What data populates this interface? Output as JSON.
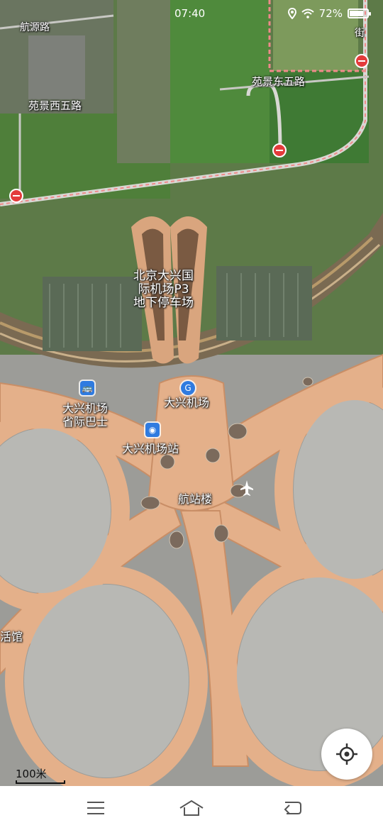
{
  "status_bar": {
    "time": "07:40",
    "battery": "72%",
    "icons": [
      "location-icon",
      "wifi-icon",
      "battery-icon"
    ]
  },
  "map": {
    "labels": {
      "road_hangyuan": "航源路",
      "road_yuanjing_west": "苑景西五路",
      "road_yuanjing_east": "苑景东五路",
      "road_street": "街",
      "parking_line1": "北京大兴国",
      "parking_line2": "际机场P3",
      "parking_line3": "地下停车场",
      "bus_line1": "大兴机场",
      "bus_line2": "省际巴士",
      "checkin": "大兴机场",
      "station": "大兴机场站",
      "terminal": "航站楼",
      "edge_left": "活馆"
    }
  },
  "scale": {
    "label": "100米"
  },
  "colors": {
    "terminal": "#e8b28c",
    "grass": "#4f8a3c",
    "poi_blue": "#2f7be0",
    "restriction_red": "#e33b3b"
  }
}
